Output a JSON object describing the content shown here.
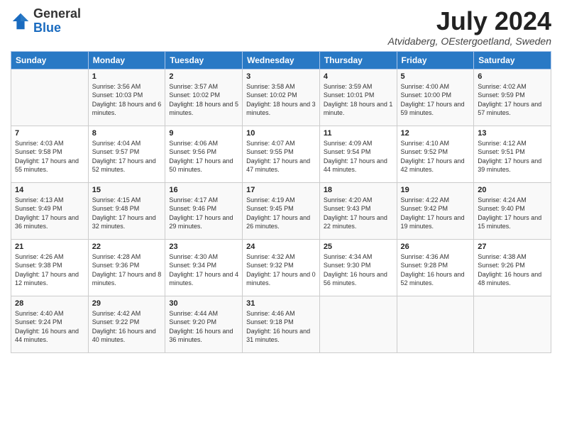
{
  "header": {
    "logo_general": "General",
    "logo_blue": "Blue",
    "month_title": "July 2024",
    "location": "Atvidaberg, OEstergoetland, Sweden"
  },
  "weekdays": [
    "Sunday",
    "Monday",
    "Tuesday",
    "Wednesday",
    "Thursday",
    "Friday",
    "Saturday"
  ],
  "weeks": [
    [
      {
        "day": "",
        "sunrise": "",
        "sunset": "",
        "daylight": ""
      },
      {
        "day": "1",
        "sunrise": "Sunrise: 3:56 AM",
        "sunset": "Sunset: 10:03 PM",
        "daylight": "Daylight: 18 hours and 6 minutes."
      },
      {
        "day": "2",
        "sunrise": "Sunrise: 3:57 AM",
        "sunset": "Sunset: 10:02 PM",
        "daylight": "Daylight: 18 hours and 5 minutes."
      },
      {
        "day": "3",
        "sunrise": "Sunrise: 3:58 AM",
        "sunset": "Sunset: 10:02 PM",
        "daylight": "Daylight: 18 hours and 3 minutes."
      },
      {
        "day": "4",
        "sunrise": "Sunrise: 3:59 AM",
        "sunset": "Sunset: 10:01 PM",
        "daylight": "Daylight: 18 hours and 1 minute."
      },
      {
        "day": "5",
        "sunrise": "Sunrise: 4:00 AM",
        "sunset": "Sunset: 10:00 PM",
        "daylight": "Daylight: 17 hours and 59 minutes."
      },
      {
        "day": "6",
        "sunrise": "Sunrise: 4:02 AM",
        "sunset": "Sunset: 9:59 PM",
        "daylight": "Daylight: 17 hours and 57 minutes."
      }
    ],
    [
      {
        "day": "7",
        "sunrise": "Sunrise: 4:03 AM",
        "sunset": "Sunset: 9:58 PM",
        "daylight": "Daylight: 17 hours and 55 minutes."
      },
      {
        "day": "8",
        "sunrise": "Sunrise: 4:04 AM",
        "sunset": "Sunset: 9:57 PM",
        "daylight": "Daylight: 17 hours and 52 minutes."
      },
      {
        "day": "9",
        "sunrise": "Sunrise: 4:06 AM",
        "sunset": "Sunset: 9:56 PM",
        "daylight": "Daylight: 17 hours and 50 minutes."
      },
      {
        "day": "10",
        "sunrise": "Sunrise: 4:07 AM",
        "sunset": "Sunset: 9:55 PM",
        "daylight": "Daylight: 17 hours and 47 minutes."
      },
      {
        "day": "11",
        "sunrise": "Sunrise: 4:09 AM",
        "sunset": "Sunset: 9:54 PM",
        "daylight": "Daylight: 17 hours and 44 minutes."
      },
      {
        "day": "12",
        "sunrise": "Sunrise: 4:10 AM",
        "sunset": "Sunset: 9:52 PM",
        "daylight": "Daylight: 17 hours and 42 minutes."
      },
      {
        "day": "13",
        "sunrise": "Sunrise: 4:12 AM",
        "sunset": "Sunset: 9:51 PM",
        "daylight": "Daylight: 17 hours and 39 minutes."
      }
    ],
    [
      {
        "day": "14",
        "sunrise": "Sunrise: 4:13 AM",
        "sunset": "Sunset: 9:49 PM",
        "daylight": "Daylight: 17 hours and 36 minutes."
      },
      {
        "day": "15",
        "sunrise": "Sunrise: 4:15 AM",
        "sunset": "Sunset: 9:48 PM",
        "daylight": "Daylight: 17 hours and 32 minutes."
      },
      {
        "day": "16",
        "sunrise": "Sunrise: 4:17 AM",
        "sunset": "Sunset: 9:46 PM",
        "daylight": "Daylight: 17 hours and 29 minutes."
      },
      {
        "day": "17",
        "sunrise": "Sunrise: 4:19 AM",
        "sunset": "Sunset: 9:45 PM",
        "daylight": "Daylight: 17 hours and 26 minutes."
      },
      {
        "day": "18",
        "sunrise": "Sunrise: 4:20 AM",
        "sunset": "Sunset: 9:43 PM",
        "daylight": "Daylight: 17 hours and 22 minutes."
      },
      {
        "day": "19",
        "sunrise": "Sunrise: 4:22 AM",
        "sunset": "Sunset: 9:42 PM",
        "daylight": "Daylight: 17 hours and 19 minutes."
      },
      {
        "day": "20",
        "sunrise": "Sunrise: 4:24 AM",
        "sunset": "Sunset: 9:40 PM",
        "daylight": "Daylight: 17 hours and 15 minutes."
      }
    ],
    [
      {
        "day": "21",
        "sunrise": "Sunrise: 4:26 AM",
        "sunset": "Sunset: 9:38 PM",
        "daylight": "Daylight: 17 hours and 12 minutes."
      },
      {
        "day": "22",
        "sunrise": "Sunrise: 4:28 AM",
        "sunset": "Sunset: 9:36 PM",
        "daylight": "Daylight: 17 hours and 8 minutes."
      },
      {
        "day": "23",
        "sunrise": "Sunrise: 4:30 AM",
        "sunset": "Sunset: 9:34 PM",
        "daylight": "Daylight: 17 hours and 4 minutes."
      },
      {
        "day": "24",
        "sunrise": "Sunrise: 4:32 AM",
        "sunset": "Sunset: 9:32 PM",
        "daylight": "Daylight: 17 hours and 0 minutes."
      },
      {
        "day": "25",
        "sunrise": "Sunrise: 4:34 AM",
        "sunset": "Sunset: 9:30 PM",
        "daylight": "Daylight: 16 hours and 56 minutes."
      },
      {
        "day": "26",
        "sunrise": "Sunrise: 4:36 AM",
        "sunset": "Sunset: 9:28 PM",
        "daylight": "Daylight: 16 hours and 52 minutes."
      },
      {
        "day": "27",
        "sunrise": "Sunrise: 4:38 AM",
        "sunset": "Sunset: 9:26 PM",
        "daylight": "Daylight: 16 hours and 48 minutes."
      }
    ],
    [
      {
        "day": "28",
        "sunrise": "Sunrise: 4:40 AM",
        "sunset": "Sunset: 9:24 PM",
        "daylight": "Daylight: 16 hours and 44 minutes."
      },
      {
        "day": "29",
        "sunrise": "Sunrise: 4:42 AM",
        "sunset": "Sunset: 9:22 PM",
        "daylight": "Daylight: 16 hours and 40 minutes."
      },
      {
        "day": "30",
        "sunrise": "Sunrise: 4:44 AM",
        "sunset": "Sunset: 9:20 PM",
        "daylight": "Daylight: 16 hours and 36 minutes."
      },
      {
        "day": "31",
        "sunrise": "Sunrise: 4:46 AM",
        "sunset": "Sunset: 9:18 PM",
        "daylight": "Daylight: 16 hours and 31 minutes."
      },
      {
        "day": "",
        "sunrise": "",
        "sunset": "",
        "daylight": ""
      },
      {
        "day": "",
        "sunrise": "",
        "sunset": "",
        "daylight": ""
      },
      {
        "day": "",
        "sunrise": "",
        "sunset": "",
        "daylight": ""
      }
    ]
  ]
}
